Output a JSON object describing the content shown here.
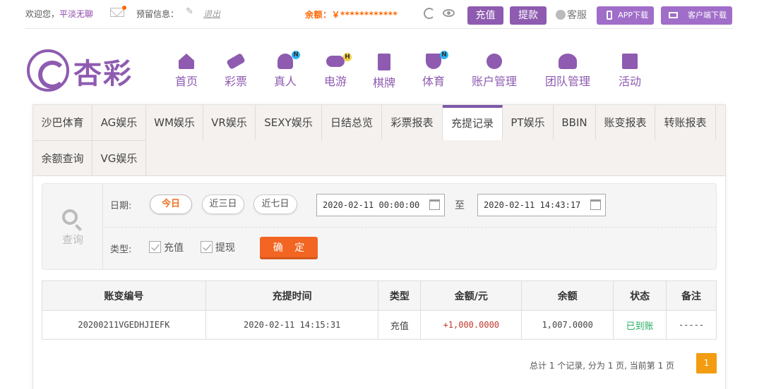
{
  "topbar": {
    "welcome_prefix": "欢迎您，",
    "username": "平淡无聊",
    "reserve_label": "预留信息：",
    "logout_label": "退出",
    "balance_label": "余额：￥************",
    "recharge_label": "充值",
    "withdraw_label": "提款",
    "service_label": "客服",
    "app_download_label": "APP下载",
    "client_download_label": "客户端下载"
  },
  "logo": {
    "brand": "杏彩"
  },
  "nav": [
    {
      "label": "首页",
      "icon": "home-icon"
    },
    {
      "label": "彩票",
      "icon": "ticket-icon"
    },
    {
      "label": "真人",
      "icon": "live-dealer-icon",
      "tag": "N"
    },
    {
      "label": "电游",
      "icon": "gamepad-icon",
      "tag": "H"
    },
    {
      "label": "棋牌",
      "icon": "cards-icon"
    },
    {
      "label": "体育",
      "icon": "trophy-icon",
      "tag": "N"
    },
    {
      "label": "账户管理",
      "icon": "yen-icon"
    },
    {
      "label": "团队管理",
      "icon": "team-icon"
    },
    {
      "label": "活动",
      "icon": "gift-icon"
    }
  ],
  "tabs": [
    "沙巴体育",
    "AG娱乐",
    "WM娱乐",
    "VR娱乐",
    "SEXY娱乐",
    "日结总览",
    "彩票报表",
    "充提记录",
    "PT娱乐",
    "BBIN",
    "账变报表",
    "转账报表",
    "余额查询",
    "VG娱乐"
  ],
  "active_tab": "充提记录",
  "filter": {
    "query_label": "查询",
    "date_label": "日期:",
    "quick_ranges": [
      "今日",
      "近三日",
      "近七日"
    ],
    "start_date": "2020-02-11 00:00:00",
    "to_label": "至",
    "end_date": "2020-02-11 14:43:17",
    "type_label": "类型:",
    "types": [
      "充值",
      "提现"
    ],
    "confirm_label": "确 定"
  },
  "table": {
    "headers": [
      "账变编号",
      "充提时间",
      "类型",
      "金额/元",
      "余额",
      "状态",
      "备注"
    ],
    "rows": [
      [
        "20200211VGEDHJIEFK",
        "2020-02-11 14:15:31",
        "充值",
        "+1,000.0000",
        "1,007.0000",
        "已到账",
        "-----"
      ]
    ]
  },
  "pager": {
    "summary": "总计 1 个记录, 分为 1 页, 当前第 1 页",
    "current": "1"
  },
  "colors": {
    "brand": "#8e5bb0",
    "accent": "#f26522",
    "success": "#27ae60"
  }
}
